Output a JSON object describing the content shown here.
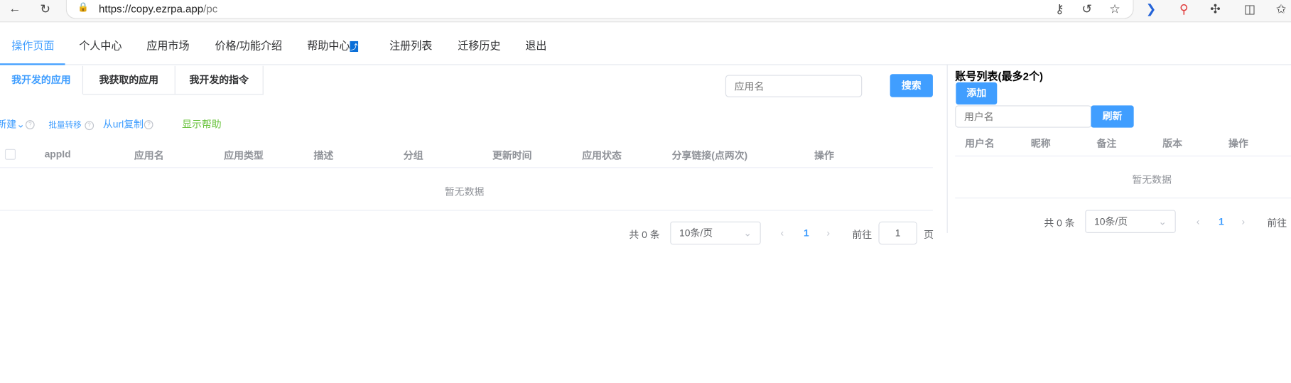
{
  "browser": {
    "url_host": "https://copy.ezrpa.app",
    "url_path": "/pc"
  },
  "nav": {
    "items": [
      {
        "label": "操作页面"
      },
      {
        "label": "个人中心"
      },
      {
        "label": "应用市场"
      },
      {
        "label": "价格/功能介绍"
      },
      {
        "label": "帮助中心"
      },
      {
        "label": "注册列表"
      },
      {
        "label": "迁移历史"
      },
      {
        "label": "退出"
      }
    ],
    "help_badge": "⤴"
  },
  "tabs": [
    {
      "label": "我开发的应用"
    },
    {
      "label": "我获取的应用"
    },
    {
      "label": "我开发的指令"
    }
  ],
  "search": {
    "placeholder": "应用名",
    "button": "搜索"
  },
  "actions": {
    "new": "新建",
    "batch": "批量转移",
    "copy_url": "从url复制",
    "show_help": "显示帮助"
  },
  "table": {
    "columns": [
      "appId",
      "应用名",
      "应用类型",
      "描述",
      "分组",
      "更新时间",
      "应用状态",
      "分享链接(点两次)",
      "操作"
    ],
    "empty": "暂无数据"
  },
  "pagination": {
    "total": "共 0 条",
    "page_size": "10条/页",
    "current": "1",
    "goto": "前往",
    "goto_value": "1",
    "page_suffix": "页"
  },
  "accounts": {
    "title": "账号列表(最多2个)",
    "add": "添加",
    "placeholder": "用户名",
    "refresh": "刷新",
    "columns": [
      "用户名",
      "昵称",
      "备注",
      "版本",
      "操作"
    ],
    "empty": "暂无数据",
    "total": "共 0 条",
    "page_size": "10条/页",
    "current": "1",
    "goto": "前往"
  },
  "colors": {
    "accent": "#409eff",
    "help_green": "#67c23a"
  }
}
